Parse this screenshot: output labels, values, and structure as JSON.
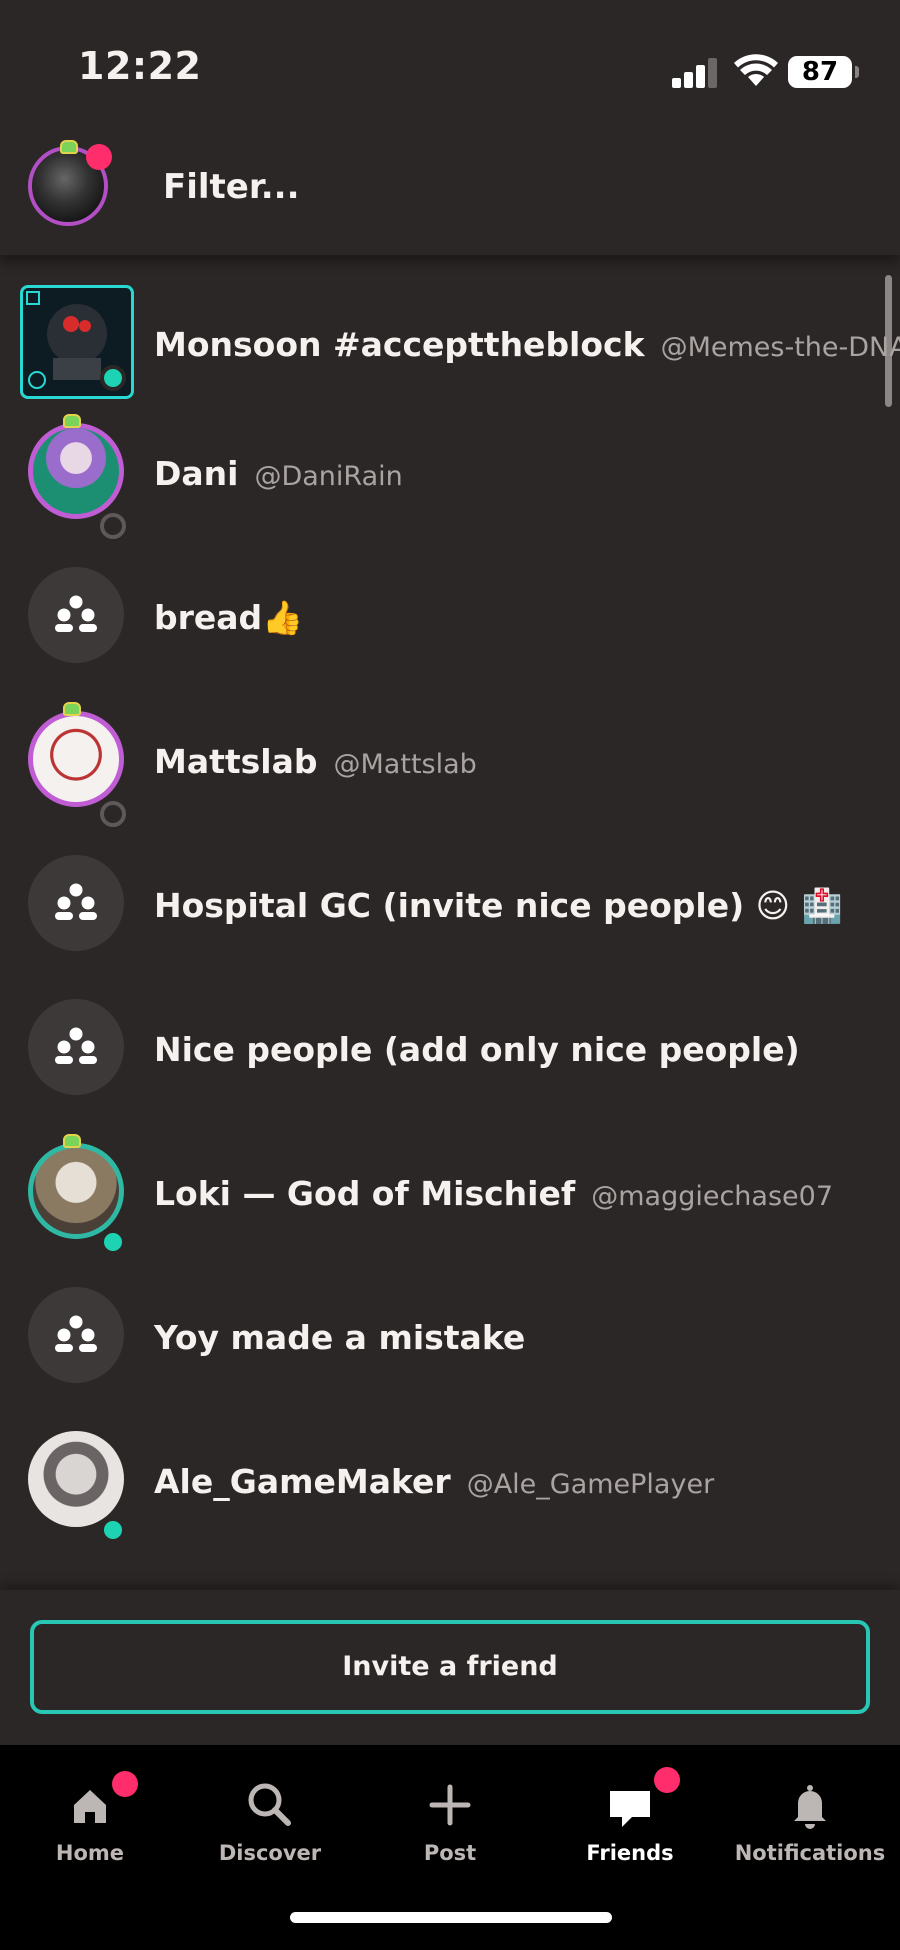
{
  "status_bar": {
    "time": "12:22",
    "battery": "87"
  },
  "filter": {
    "placeholder": "Filter..."
  },
  "friends": [
    {
      "name": "Monsoon #accepttheblock",
      "handle": "@Memes-the-DNA",
      "type": "user",
      "status": "online"
    },
    {
      "name": "Dani",
      "handle": "@DaniRain",
      "type": "user",
      "status": "offline"
    },
    {
      "name": "bread👍",
      "handle": "",
      "type": "group"
    },
    {
      "name": "Mattslab",
      "handle": "@Mattslab",
      "type": "user",
      "status": "offline"
    },
    {
      "name": "Hospital GC (invite nice people) 😊 🏥",
      "handle": "",
      "type": "group"
    },
    {
      "name": "Nice people (add only nice people)",
      "handle": "",
      "type": "group"
    },
    {
      "name": "Loki — God of Mischief",
      "handle": "@maggiechase07",
      "type": "user",
      "status": "online"
    },
    {
      "name": "Yoy made a mistake",
      "handle": "",
      "type": "group"
    },
    {
      "name": "Ale_GameMaker",
      "handle": "@Ale_GamePlayer",
      "type": "user",
      "status": "online"
    }
  ],
  "invite": {
    "label": "Invite a friend"
  },
  "tabs": [
    {
      "label": "Home",
      "icon": "home-icon",
      "badge": true
    },
    {
      "label": "Discover",
      "icon": "search-icon",
      "badge": false
    },
    {
      "label": "Post",
      "icon": "plus-icon",
      "badge": false
    },
    {
      "label": "Friends",
      "icon": "chat-bubble-icon",
      "badge": true,
      "active": true
    },
    {
      "label": "Notifications",
      "icon": "bell-icon",
      "badge": false
    }
  ],
  "colors": {
    "accent": "#27c7b4",
    "badge": "#ff2d6b",
    "online": "#1ed2b4",
    "background": "#2b2726"
  }
}
